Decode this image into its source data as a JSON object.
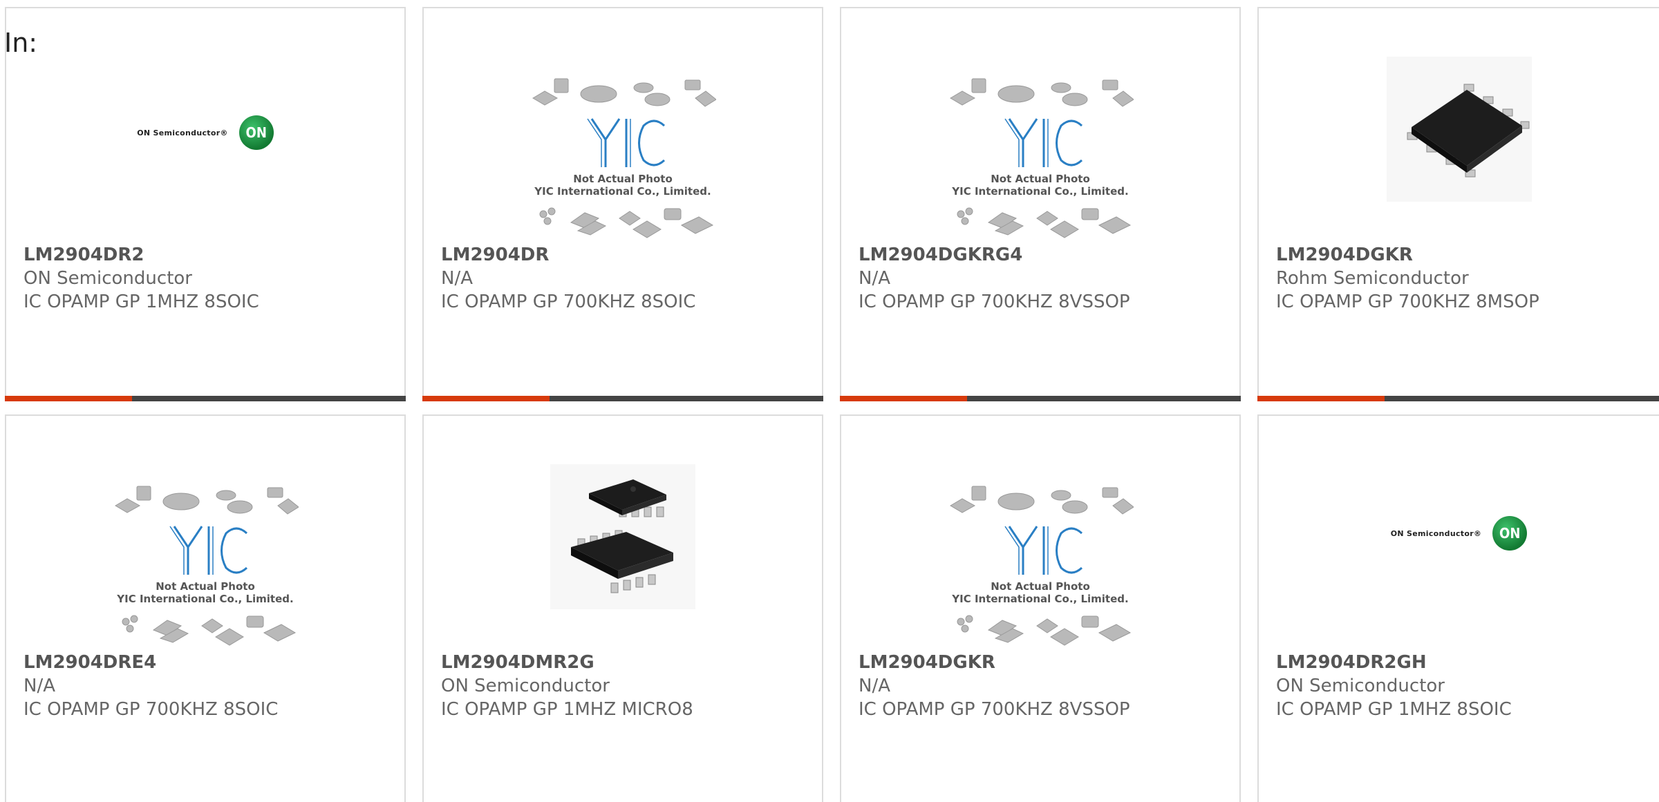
{
  "header": {
    "label": "In:"
  },
  "colors": {
    "accent": "#d73a0c",
    "bar": "#444444",
    "border": "#dcdcdc"
  },
  "yic_placeholder": {
    "line1": "Not Actual Photo",
    "line2": "YIC International Co., Limited."
  },
  "on_logo": {
    "wordmark": "ON Semiconductor®",
    "badge": "ON"
  },
  "products": [
    {
      "part": "LM2904DR2",
      "manufacturer": "ON Semiconductor",
      "description": "IC OPAMP GP 1MHZ 8SOIC",
      "image": "on-semiconductor-logo"
    },
    {
      "part": "LM2904DR",
      "manufacturer": "N/A",
      "description": "IC OPAMP GP 700KHZ 8SOIC",
      "image": "yic-not-actual-photo"
    },
    {
      "part": "LM2904DGKRG4",
      "manufacturer": "N/A",
      "description": "IC OPAMP GP 700KHZ 8VSSOP",
      "image": "yic-not-actual-photo"
    },
    {
      "part": "LM2904DGKR",
      "manufacturer": "Rohm Semiconductor",
      "description": "IC OPAMP GP 700KHZ 8MSOP",
      "image": "soic-chip-photo"
    },
    {
      "part": "LM2904DRE4",
      "manufacturer": "N/A",
      "description": "IC OPAMP GP 700KHZ 8SOIC",
      "image": "yic-not-actual-photo"
    },
    {
      "part": "LM2904DMR2G",
      "manufacturer": "ON Semiconductor",
      "description": "IC OPAMP GP 1MHZ MICRO8",
      "image": "micro8-chip-photo"
    },
    {
      "part": "LM2904DGKR",
      "manufacturer": "N/A",
      "description": "IC OPAMP GP 700KHZ 8VSSOP",
      "image": "yic-not-actual-photo"
    },
    {
      "part": "LM2904DR2GH",
      "manufacturer": "ON Semiconductor",
      "description": "IC OPAMP GP 1MHZ 8SOIC",
      "image": "on-semiconductor-logo"
    }
  ]
}
